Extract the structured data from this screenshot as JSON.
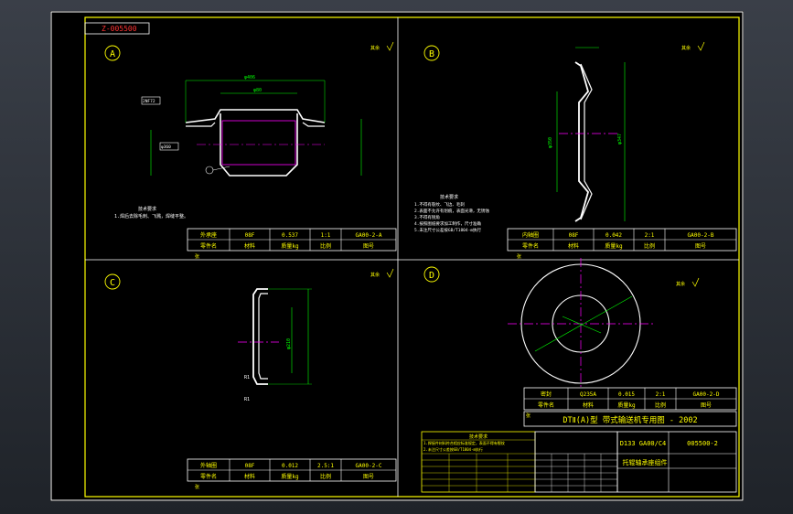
{
  "drawing_number_tag": "Z-005500",
  "views": [
    {
      "id": "A",
      "label": "A",
      "roughness": "其余",
      "notes_title": "技术要求",
      "notes": [
        "1.焊后去除毛刺、飞溅，焊缝平整。"
      ],
      "dims": {
        "top": "φ406",
        "mid": "φ80",
        "left1": "2NF72",
        "left2": "φ360"
      }
    },
    {
      "id": "B",
      "label": "B",
      "roughness": "其余",
      "notes_title": "技术要求",
      "notes": [
        "1.不得有裂纹、飞边、毛刺",
        "2.表面不允许有划痕，表面光滑，无锈蚀",
        "3.不得有锐角",
        "4.按照图纸要求加工制作，尺寸准确",
        "5.未注尺寸公差按GB/T1804-m执行"
      ],
      "dims": {
        "left": "φ350",
        "right": "φ347"
      }
    },
    {
      "id": "C",
      "label": "C",
      "roughness": "其余",
      "dims": {
        "r1": "R1",
        "r2": "R1",
        "mid": "φ210"
      }
    },
    {
      "id": "D",
      "label": "D",
      "roughness": "其余"
    }
  ],
  "title_blocks": [
    {
      "id": "tb-a",
      "row1": [
        "外承座",
        "08F",
        "0.537",
        "1:1",
        "GA00-2-A"
      ],
      "row2": [
        "零件名",
        "材料",
        "质量kg",
        "比例",
        "图号"
      ]
    },
    {
      "id": "tb-b",
      "row1": [
        "内轴圈",
        "08F",
        "0.042",
        "2:1",
        "GA00-2-B"
      ],
      "row2": [
        "零件名",
        "材料",
        "质量kg",
        "比例",
        "图号"
      ]
    },
    {
      "id": "tb-c",
      "row1": [
        "外轴圈",
        "08F",
        "0.012",
        "2.5:1",
        "GA00-2-C"
      ],
      "row2": [
        "零件名",
        "材料",
        "质量kg",
        "比例",
        "图号"
      ]
    },
    {
      "id": "tb-d",
      "row1": [
        "密封",
        "Q235A",
        "0.015",
        "2:1",
        "GA00-2-D"
      ],
      "row2": [
        "零件名",
        "材料",
        "质量kg",
        "比例",
        "图号"
      ]
    }
  ],
  "main_title": "DTⅡ(A)型 带式输送机专用图 - 2002",
  "code_left": "D133 GA00/C4",
  "code_right": "005500-2",
  "part_name": "托辊轴承座组件",
  "tech_table_title": "技术要求",
  "tech_lines": [
    "1.焊接件材料符合相应标准规定，表面不得有裂纹",
    "2.未注尺寸公差按GB/T1804-m执行"
  ],
  "footer_label": "张"
}
